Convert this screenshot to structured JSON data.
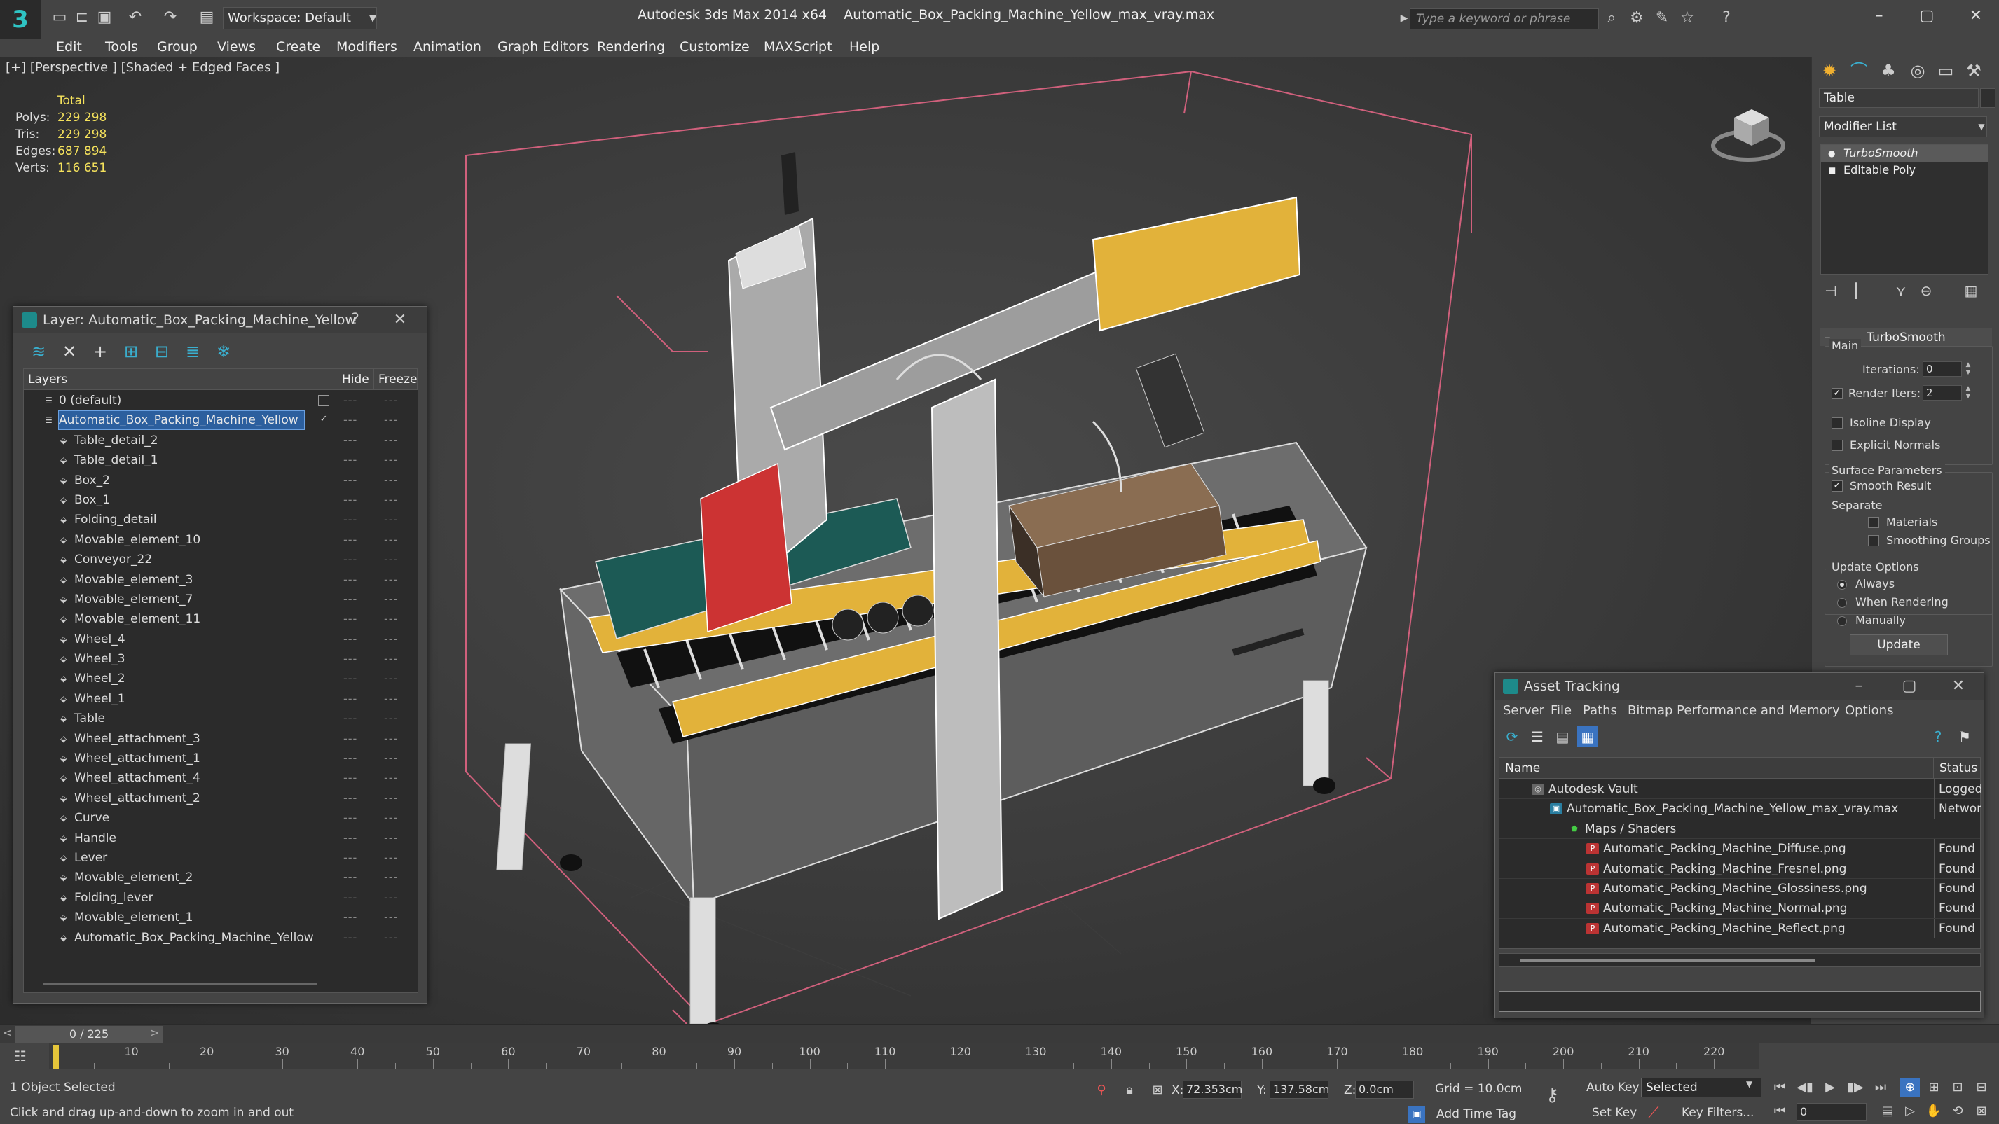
{
  "titlebar": {
    "workspace": "Workspace: Default",
    "app_name": "Autodesk 3ds Max  2014 x64",
    "file_name": "Automatic_Box_Packing_Machine_Yellow_max_vray.max",
    "search_placeholder": "Type a keyword or phrase"
  },
  "menubar": [
    "Edit",
    "Tools",
    "Group",
    "Views",
    "Create",
    "Modifiers",
    "Animation",
    "Graph Editors",
    "Rendering",
    "Customize",
    "MAXScript",
    "Help"
  ],
  "viewport": {
    "label": "[+] [Perspective ] [Shaded + Edged Faces ]",
    "stats": {
      "header": "Total",
      "rows": [
        {
          "label": "Polys:",
          "value": "229 298"
        },
        {
          "label": "Tris:",
          "value": "229 298"
        },
        {
          "label": "Edges:",
          "value": "687 894"
        },
        {
          "label": "Verts:",
          "value": "116 651"
        }
      ]
    }
  },
  "command_panel": {
    "object_name": "Table",
    "modifier_list": "Modifier List",
    "stack": [
      {
        "name": "TurboSmooth",
        "selected": true
      },
      {
        "name": "Editable Poly",
        "selected": false
      }
    ],
    "turbosmooth": {
      "title": "TurboSmooth",
      "main_label": "Main",
      "iterations_label": "Iterations:",
      "iterations_value": "0",
      "render_iters_label": "Render Iters:",
      "render_iters_value": "2",
      "isoline": "Isoline Display",
      "explicit_normals": "Explicit Normals",
      "surface_params": "Surface Parameters",
      "smooth_result": "Smooth Result",
      "separate": "Separate",
      "materials": "Materials",
      "smoothing_groups": "Smoothing Groups",
      "update_options": "Update Options",
      "always": "Always",
      "when_rendering": "When Rendering",
      "manually": "Manually",
      "update_button": "Update"
    }
  },
  "layer_window": {
    "title": "Layer: Automatic_Box_Packing_Machine_Yellow",
    "help": "?",
    "columns": {
      "layers": "Layers",
      "hide": "Hide",
      "freeze": "Freeze"
    },
    "rows": [
      {
        "name": "0 (default)",
        "level": 0,
        "type": "layer"
      },
      {
        "name": "Automatic_Box_Packing_Machine_Yellow",
        "level": 0,
        "type": "layer",
        "selected": true
      },
      {
        "name": "Table_detail_2",
        "level": 1,
        "type": "object"
      },
      {
        "name": "Table_detail_1",
        "level": 1,
        "type": "object"
      },
      {
        "name": "Box_2",
        "level": 1,
        "type": "object"
      },
      {
        "name": "Box_1",
        "level": 1,
        "type": "object"
      },
      {
        "name": "Folding_detail",
        "level": 1,
        "type": "object"
      },
      {
        "name": "Movable_element_10",
        "level": 1,
        "type": "object"
      },
      {
        "name": "Conveyor_22",
        "level": 1,
        "type": "object"
      },
      {
        "name": "Movable_element_3",
        "level": 1,
        "type": "object"
      },
      {
        "name": "Movable_element_7",
        "level": 1,
        "type": "object"
      },
      {
        "name": "Movable_element_11",
        "level": 1,
        "type": "object"
      },
      {
        "name": "Wheel_4",
        "level": 1,
        "type": "object"
      },
      {
        "name": "Wheel_3",
        "level": 1,
        "type": "object"
      },
      {
        "name": "Wheel_2",
        "level": 1,
        "type": "object"
      },
      {
        "name": "Wheel_1",
        "level": 1,
        "type": "object"
      },
      {
        "name": "Table",
        "level": 1,
        "type": "object"
      },
      {
        "name": "Wheel_attachment_3",
        "level": 1,
        "type": "object"
      },
      {
        "name": "Wheel_attachment_1",
        "level": 1,
        "type": "object"
      },
      {
        "name": "Wheel_attachment_4",
        "level": 1,
        "type": "object"
      },
      {
        "name": "Wheel_attachment_2",
        "level": 1,
        "type": "object"
      },
      {
        "name": "Curve",
        "level": 1,
        "type": "object"
      },
      {
        "name": "Handle",
        "level": 1,
        "type": "object"
      },
      {
        "name": "Lever",
        "level": 1,
        "type": "object"
      },
      {
        "name": "Movable_element_2",
        "level": 1,
        "type": "object"
      },
      {
        "name": "Folding_lever",
        "level": 1,
        "type": "object"
      },
      {
        "name": "Movable_element_1",
        "level": 1,
        "type": "object"
      },
      {
        "name": "Automatic_Box_Packing_Machine_Yellow",
        "level": 1,
        "type": "object"
      }
    ]
  },
  "asset_window": {
    "title": "Asset Tracking",
    "menu": [
      "Server",
      "File",
      "Paths",
      "Bitmap Performance and Memory",
      "Options"
    ],
    "columns": {
      "name": "Name",
      "status": "Status"
    },
    "rows": [
      {
        "name": "Autodesk Vault",
        "level": 1,
        "icon": "vault",
        "status": "Logged"
      },
      {
        "name": "Automatic_Box_Packing_Machine_Yellow_max_vray.max",
        "level": 2,
        "icon": "max",
        "status": "Networ"
      },
      {
        "name": "Maps / Shaders",
        "level": 3,
        "icon": "maps",
        "status": ""
      },
      {
        "name": "Automatic_Packing_Machine_Diffuse.png",
        "level": 4,
        "icon": "png",
        "status": "Found"
      },
      {
        "name": "Automatic_Packing_Machine_Fresnel.png",
        "level": 4,
        "icon": "png",
        "status": "Found"
      },
      {
        "name": "Automatic_Packing_Machine_Glossiness.png",
        "level": 4,
        "icon": "png",
        "status": "Found"
      },
      {
        "name": "Automatic_Packing_Machine_Normal.png",
        "level": 4,
        "icon": "png",
        "status": "Found"
      },
      {
        "name": "Automatic_Packing_Machine_Reflect.png",
        "level": 4,
        "icon": "png",
        "status": "Found"
      }
    ]
  },
  "timeline": {
    "slider": "0 / 225",
    "ticks": [
      "10",
      "20",
      "30",
      "40",
      "50",
      "60",
      "70",
      "80",
      "90",
      "100",
      "110",
      "120",
      "130",
      "140",
      "150",
      "160",
      "170",
      "180",
      "190",
      "200",
      "210",
      "220"
    ],
    "current_frame": 0,
    "total_frames": 225
  },
  "statusbar": {
    "selection": "1 Object Selected",
    "prompt": "Click and drag up-and-down to zoom in and out",
    "x_label": "X:",
    "x_value": "72.353cm",
    "y_label": "Y:",
    "y_value": "137.58cm",
    "z_label": "Z:",
    "z_value": "0.0cm",
    "grid": "Grid = 10.0cm",
    "add_time_tag": "Add Time Tag",
    "auto_key": "Auto Key",
    "set_key": "Set Key",
    "selected_mode": "Selected",
    "key_filters": "Key Filters...",
    "frame_value": "0"
  },
  "colors": {
    "accent_blue": "#2c5f9e",
    "stats_yellow": "#f5e25c",
    "machine_yellow": "#e2b23a",
    "bbox_pink": "#d0607c"
  }
}
